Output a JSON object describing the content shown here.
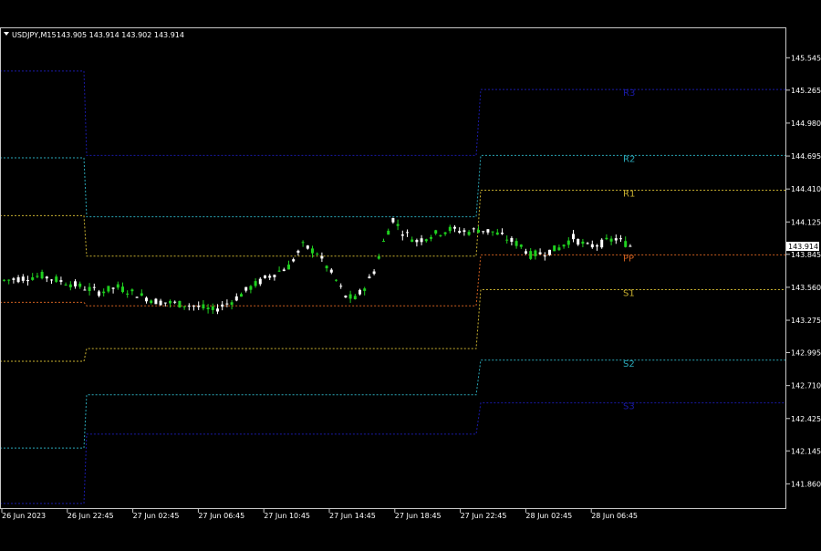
{
  "header": {
    "symbol_timeframe": "USDJPY,M15",
    "quote": "143.905 143.914 143.902 143.914"
  },
  "colors": {
    "background": "#000000",
    "axis": "#c8c8c8",
    "text": "#ffffff",
    "bull": "#1fd01f",
    "bear": "#ffffff",
    "price_label_bg": "#ffffff",
    "price_label_text": "#000000"
  },
  "chart_data": {
    "type": "candlestick",
    "symbol": "USDJPY",
    "timeframe": "M15",
    "current_price": 143.914,
    "y_axis": {
      "range": [
        141.65,
        145.8
      ],
      "ticks": [
        "145.545",
        "145.265",
        "144.980",
        "144.695",
        "144.410",
        "144.125",
        "143.845",
        "143.560",
        "143.275",
        "142.995",
        "142.710",
        "142.425",
        "142.145",
        "141.860"
      ]
    },
    "x_axis": {
      "ticks": [
        "26 Jun 2023",
        "26 Jun 22:45",
        "27 Jun 02:45",
        "27 Jun 06:45",
        "27 Jun 10:45",
        "27 Jun 14:45",
        "27 Jun 18:45",
        "27 Jun 22:45",
        "28 Jun 02:45",
        "28 Jun 06:45"
      ]
    },
    "pivot_levels": [
      {
        "label": "R3",
        "color": "#1a1aa8",
        "values": [
          145.43,
          144.7,
          145.27
        ]
      },
      {
        "label": "R2",
        "color": "#2aa8b8",
        "values": [
          144.68,
          144.17,
          144.7
        ]
      },
      {
        "label": "R1",
        "color": "#c8b030",
        "values": [
          144.18,
          143.83,
          144.4
        ]
      },
      {
        "label": "PP",
        "color": "#d06020",
        "values": [
          143.43,
          143.4,
          143.84
        ]
      },
      {
        "label": "S1",
        "color": "#c8b030",
        "values": [
          142.92,
          143.03,
          143.54
        ]
      },
      {
        "label": "S2",
        "color": "#2aa8b8",
        "values": [
          142.17,
          142.63,
          142.93
        ]
      },
      {
        "label": "S3",
        "color": "#1a1aa8",
        "values": [
          141.69,
          142.29,
          142.56
        ]
      }
    ],
    "price_path": [
      [
        0,
        143.62
      ],
      [
        8,
        143.66
      ],
      [
        15,
        143.58
      ],
      [
        20,
        143.52
      ],
      [
        24,
        143.56
      ],
      [
        28,
        143.5
      ],
      [
        32,
        143.44
      ],
      [
        36,
        143.42
      ],
      [
        40,
        143.4
      ],
      [
        44,
        143.36
      ],
      [
        48,
        143.44
      ],
      [
        52,
        143.56
      ],
      [
        56,
        143.66
      ],
      [
        60,
        143.74
      ],
      [
        63,
        143.92
      ],
      [
        66,
        143.86
      ],
      [
        68,
        143.74
      ],
      [
        70,
        143.62
      ],
      [
        72,
        143.48
      ],
      [
        74,
        143.46
      ],
      [
        76,
        143.56
      ],
      [
        78,
        143.7
      ],
      [
        80,
        143.95
      ],
      [
        82,
        144.15
      ],
      [
        84,
        144.04
      ],
      [
        87,
        143.96
      ],
      [
        90,
        144.01
      ],
      [
        94,
        144.06
      ],
      [
        98,
        144.04
      ],
      [
        100,
        144.06
      ],
      [
        103,
        144.04
      ],
      [
        106,
        143.98
      ],
      [
        109,
        143.92
      ],
      [
        111,
        143.84
      ],
      [
        114,
        143.86
      ],
      [
        117,
        143.9
      ],
      [
        120,
        143.99
      ],
      [
        123,
        143.91
      ],
      [
        126,
        143.94
      ],
      [
        129,
        143.98
      ],
      [
        132,
        143.92
      ]
    ]
  }
}
